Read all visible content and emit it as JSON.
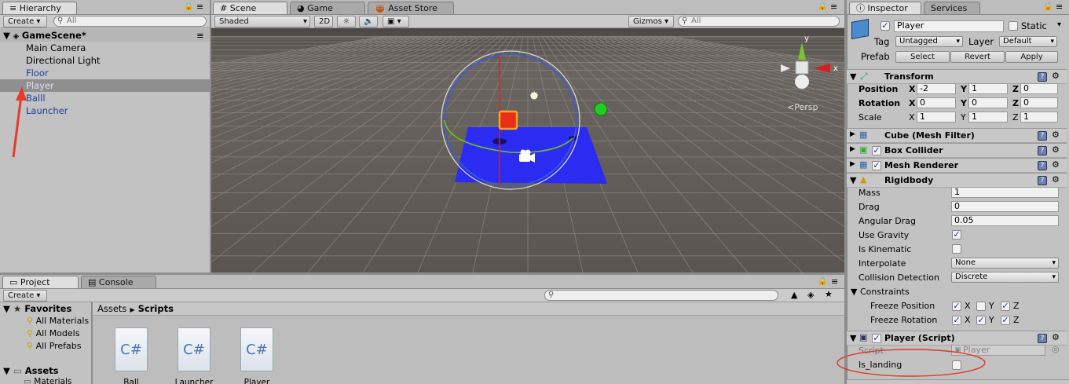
{
  "hierarchy": {
    "tab_label": "Hierarchy",
    "create_label": "Create ▾",
    "search_placeholder": "All",
    "scene_name": "GameScene*",
    "items": [
      {
        "label": "Main Camera",
        "color": "#000000"
      },
      {
        "label": "Directional Light",
        "color": "#000000"
      },
      {
        "label": "Floor",
        "color": "#1a3fa0"
      },
      {
        "label": "Player",
        "color": "#1a3fa0",
        "selected": true
      },
      {
        "label": "Balll",
        "color": "#1a3fa0"
      },
      {
        "label": "Launcher",
        "color": "#1a3fa0"
      }
    ]
  },
  "scene": {
    "tabs": [
      "Scene",
      "Game",
      "Asset Store"
    ],
    "shading": "Shaded",
    "mode_2d": "2D",
    "gizmos": "Gizmos ▾",
    "search_placeholder": "All",
    "persp_label": "Persp",
    "axis_y": "y",
    "axis_x": "x"
  },
  "project": {
    "tabs": [
      "Project",
      "Console"
    ],
    "create_label": "Create ▾",
    "favorites_label": "Favorites",
    "favorites": [
      "All Materials",
      "All Models",
      "All Prefabs"
    ],
    "assets_label": "Assets",
    "assets_children": [
      "Materials"
    ],
    "breadcrumb": [
      "Assets",
      "Scripts"
    ],
    "files": [
      {
        "name": "Ball",
        "glyph": "C#"
      },
      {
        "name": "Launcher",
        "glyph": "C#"
      },
      {
        "name": "Player",
        "glyph": "C#"
      }
    ]
  },
  "inspector": {
    "tabs": [
      "Inspector",
      "Services"
    ],
    "object_name": "Player",
    "static_label": "Static",
    "tag_label": "Tag",
    "tag_value": "Untagged",
    "layer_label": "Layer",
    "layer_value": "Default",
    "prefab_label": "Prefab",
    "prefab_buttons": [
      "Select",
      "Revert",
      "Apply"
    ],
    "transform": {
      "title": "Transform",
      "position_label": "Position",
      "rotation_label": "Rotation",
      "scale_label": "Scale",
      "position": {
        "x": "-2",
        "y": "1",
        "z": "0"
      },
      "rotation": {
        "x": "0",
        "y": "0",
        "z": "0"
      },
      "scale": {
        "x": "1",
        "y": "1",
        "z": "1"
      }
    },
    "components": [
      "Cube (Mesh Filter)",
      "Box Collider",
      "Mesh Renderer"
    ],
    "rigidbody": {
      "title": "Rigidbody",
      "mass_label": "Mass",
      "mass": "1",
      "drag_label": "Drag",
      "drag": "0",
      "angular_drag_label": "Angular Drag",
      "angular_drag": "0.05",
      "use_gravity_label": "Use Gravity",
      "is_kinematic_label": "Is Kinematic",
      "interpolate_label": "Interpolate",
      "interpolate": "None",
      "collision_label": "Collision Detection",
      "collision": "Discrete",
      "constraints_label": "Constraints",
      "freeze_position_label": "Freeze Position",
      "freeze_rotation_label": "Freeze Rotation",
      "axis_x": "X",
      "axis_y": "Y",
      "axis_z": "Z"
    },
    "player_script": {
      "title": "Player (Script)",
      "script_label": "Script",
      "script_value": "Player",
      "is_landing_label": "Is_landing"
    }
  },
  "colors": {
    "accent": "#3b5fd0",
    "selection": "#8aa0c8",
    "annotation": "#e03a2a"
  }
}
